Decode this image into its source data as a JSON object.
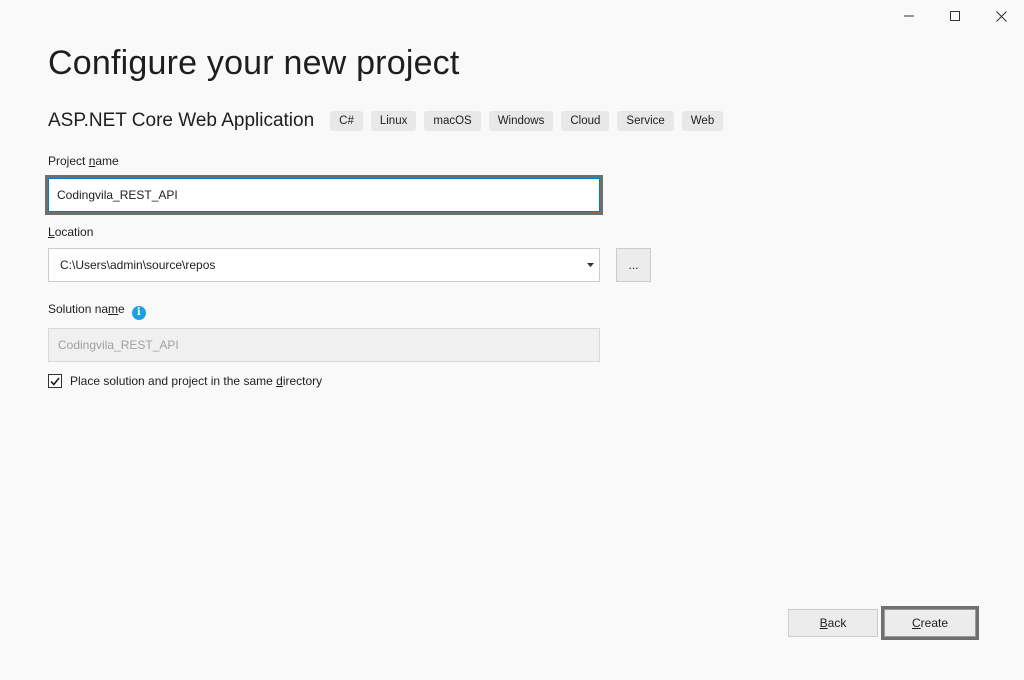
{
  "window": {
    "controls": {
      "minimize": "minimize-icon",
      "maximize": "maximize-icon",
      "close": "close-icon"
    }
  },
  "header": {
    "title": "Configure your new project"
  },
  "template": {
    "name": "ASP.NET Core Web Application",
    "tags": [
      "C#",
      "Linux",
      "macOS",
      "Windows",
      "Cloud",
      "Service",
      "Web"
    ]
  },
  "form": {
    "project_name": {
      "label_pre": "Project ",
      "label_accel": "n",
      "label_post": "ame",
      "value": "Codingvila_REST_API"
    },
    "location": {
      "label_pre": "",
      "label_accel": "L",
      "label_post": "ocation",
      "value": "C:\\Users\\admin\\source\\repos",
      "browse_label": "..."
    },
    "solution_name": {
      "label_pre": "Solution na",
      "label_accel": "m",
      "label_post": "e",
      "value": "Codingvila_REST_API",
      "info_icon": "info-icon"
    },
    "same_directory": {
      "checked": true,
      "label_pre": "Place solution and project in the same ",
      "label_accel": "d",
      "label_post": "irectory"
    }
  },
  "footer": {
    "back": {
      "accel": "B",
      "rest": "ack"
    },
    "create": {
      "accel": "C",
      "rest": "reate"
    }
  },
  "colors": {
    "background": "#f9f9f9",
    "focus_border": "#6f6f6f",
    "input_focus": "#007acc",
    "info": "#1ba1e2",
    "tag_bg": "#e8e8e8"
  }
}
